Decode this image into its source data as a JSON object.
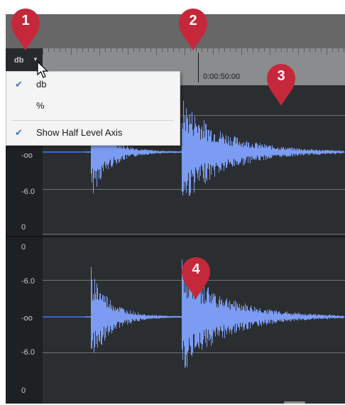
{
  "ruler": {
    "scale_button_label": "db",
    "timecode": "0:00:50:00"
  },
  "scale_menu": {
    "items": [
      {
        "label": "db",
        "checked": true
      },
      {
        "label": "%",
        "checked": false
      },
      {
        "label": "Show Half Level Axis",
        "checked": true
      }
    ]
  },
  "top_track": {
    "axis_labels": [
      "-oo",
      "-6.0",
      "0"
    ]
  },
  "bottom_track": {
    "axis_labels": [
      "0",
      "-6.0",
      "-oo",
      "-6.0",
      "0"
    ]
  },
  "callouts": [
    "1",
    "2",
    "3",
    "4"
  ],
  "colors": {
    "callout": "#c5283a",
    "waveform": "#7b9cf2",
    "check": "#3876c8"
  },
  "icons": [
    "dropdown-caret-icon",
    "checkmark-icon",
    "mouse-pointer-icon",
    "callout-pin-icon"
  ]
}
